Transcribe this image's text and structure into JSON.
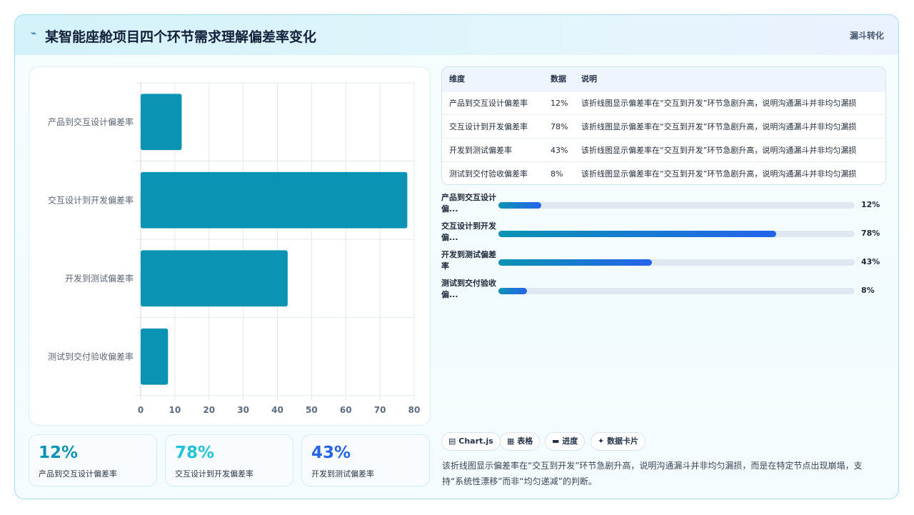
{
  "header": {
    "icon": "sparkle-icon",
    "title": "某智能座舱项目四个环节需求理解偏差率变化",
    "badge": "漏斗转化"
  },
  "chart_data": {
    "type": "bar",
    "orientation": "horizontal",
    "categories": [
      "产品到交互设计偏差率",
      "交互设计到开发偏差率",
      "开发到测试偏差率",
      "测试到交付验收偏差率"
    ],
    "values": [
      12,
      78,
      43,
      8
    ],
    "xlim": [
      0,
      80
    ],
    "xticks": [
      0,
      10,
      20,
      30,
      40,
      50,
      60,
      70,
      80
    ],
    "grid": true,
    "color": "#0a93b2"
  },
  "kpis": [
    {
      "value": "12%",
      "label": "产品到交互设计偏差率",
      "color": "#0a93b2"
    },
    {
      "value": "78%",
      "label": "交互设计到开发偏差率",
      "color": "#22c3d9"
    },
    {
      "value": "43%",
      "label": "开发到测试偏差率",
      "color": "#2563eb"
    }
  ],
  "table": {
    "headers": [
      "维度",
      "数据",
      "说明"
    ],
    "rows": [
      [
        "产品到交互设计偏差率",
        "12%",
        "该折线图显示偏差率在“交互到开发”环节急剧升高，说明沟通漏斗并非均匀漏损"
      ],
      [
        "交互设计到开发偏差率",
        "78%",
        "该折线图显示偏差率在“交互到开发”环节急剧升高，说明沟通漏斗并非均匀漏损"
      ],
      [
        "开发到测试偏差率",
        "43%",
        "该折线图显示偏差率在“交互到开发”环节急剧升高，说明沟通漏斗并非均匀漏损"
      ],
      [
        "测试到交付验收偏差率",
        "8%",
        "该折线图显示偏差率在“交互到开发”环节急剧升高，说明沟通漏斗并非均匀漏损"
      ]
    ]
  },
  "progress": [
    {
      "label": "产品到交互设计偏...",
      "value": 12,
      "text": "12%"
    },
    {
      "label": "交互设计到开发偏...",
      "value": 78,
      "text": "78%"
    },
    {
      "label": "开发到测试偏差率",
      "value": 43,
      "text": "43%"
    },
    {
      "label": "测试到交付验收偏...",
      "value": 8,
      "text": "8%"
    }
  ],
  "progress_max": 100,
  "chips": [
    {
      "icon": "chart-icon",
      "glyph": "▤",
      "label": "Chart.js"
    },
    {
      "icon": "table-icon",
      "glyph": "▦",
      "label": "表格"
    },
    {
      "icon": "progress-icon",
      "glyph": "▬",
      "label": "进度"
    },
    {
      "icon": "card-icon",
      "glyph": "✦",
      "label": "数据卡片"
    }
  ],
  "description": "该折线图显示偏差率在“交互到开发”环节急剧升高，说明沟通漏斗并非均匀漏损，而是在特定节点出现崩塌，支持“系统性漂移”而非“均匀递减”的判断。"
}
